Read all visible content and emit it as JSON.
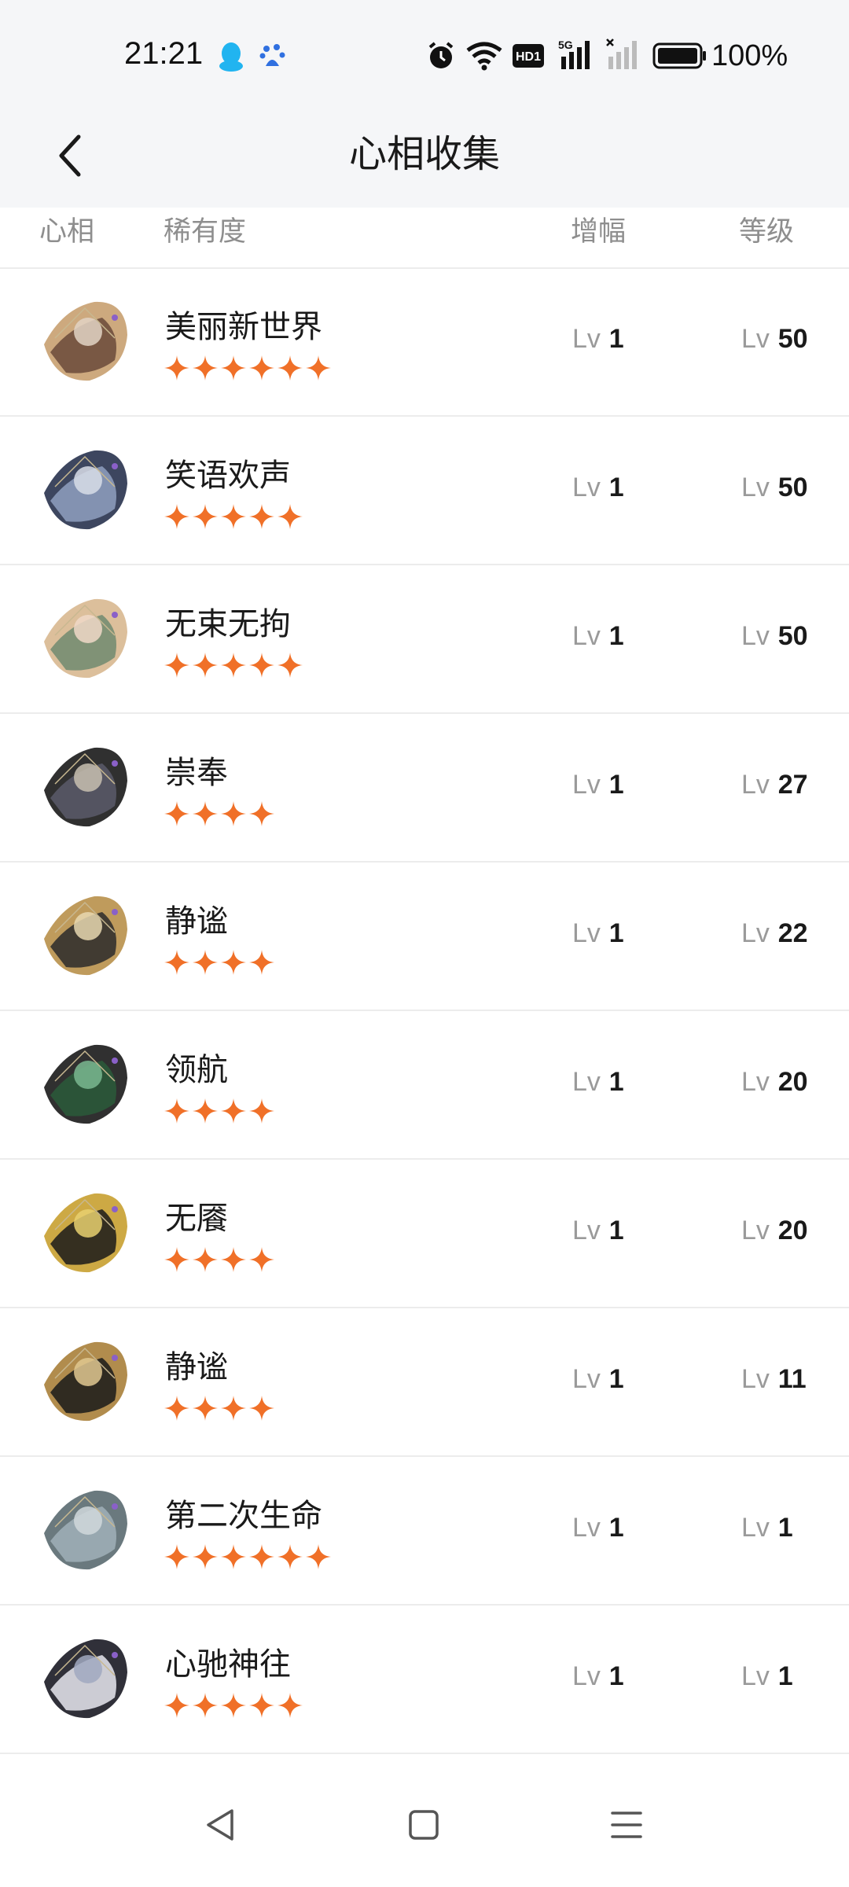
{
  "status_bar": {
    "time": "21:21",
    "battery": "100%",
    "icons": [
      "qq-icon",
      "baidu-icon",
      "alarm-icon",
      "wifi-icon",
      "hd-icon",
      "signal-5g-icon",
      "signal-no-sim-icon",
      "battery-icon"
    ],
    "network_label": "5G",
    "hd_label": "HD1"
  },
  "header": {
    "title": "心相收集",
    "back_icon": "chevron-left-icon"
  },
  "columns": {
    "card": "心相",
    "rarity": "稀有度",
    "boost": "增幅",
    "level": "等级"
  },
  "colors": {
    "star": "#f07028",
    "divider": "#ececec",
    "header_bg": "#f5f6f8"
  },
  "lv_prefix": "Lv",
  "items": [
    {
      "name": "美丽新世界",
      "stars": 6,
      "boost": "1",
      "level": "50"
    },
    {
      "name": "笑语欢声",
      "stars": 5,
      "boost": "1",
      "level": "50"
    },
    {
      "name": "无束无拘",
      "stars": 5,
      "boost": "1",
      "level": "50"
    },
    {
      "name": "崇奉",
      "stars": 4,
      "boost": "1",
      "level": "27"
    },
    {
      "name": "静谧",
      "stars": 4,
      "boost": "1",
      "level": "22"
    },
    {
      "name": "领航",
      "stars": 4,
      "boost": "1",
      "level": "20"
    },
    {
      "name": "无餍",
      "stars": 4,
      "boost": "1",
      "level": "20"
    },
    {
      "name": "静谧",
      "stars": 4,
      "boost": "1",
      "level": "11"
    },
    {
      "name": "第二次生命",
      "stars": 6,
      "boost": "1",
      "level": "1"
    },
    {
      "name": "心驰神往",
      "stars": 5,
      "boost": "1",
      "level": "1"
    }
  ],
  "nav_bar": {
    "icons": [
      "back-triangle-icon",
      "home-square-icon",
      "menu-lines-icon"
    ]
  }
}
